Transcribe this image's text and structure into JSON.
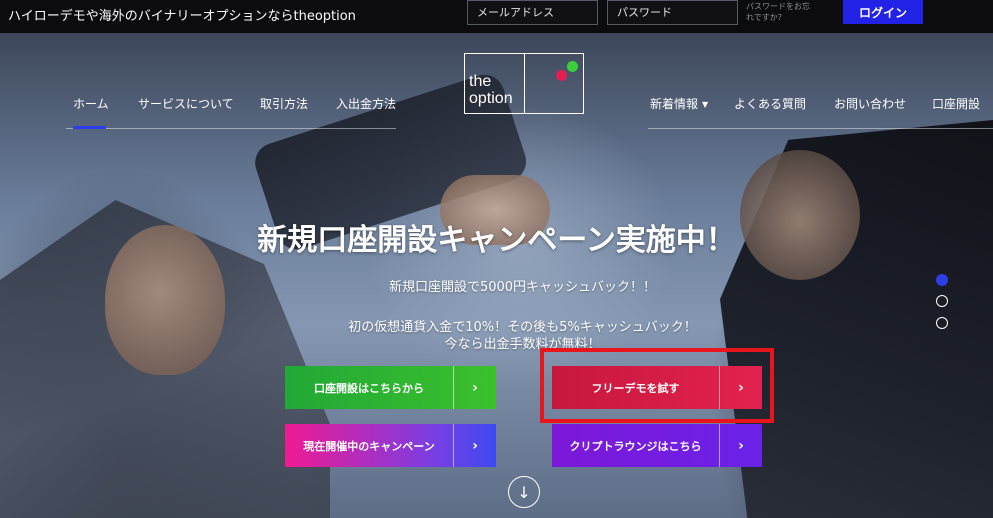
{
  "topbar": {
    "tagline": "ハイローデモや海外のバイナリーオプションならtheoption",
    "email_placeholder": "メールアドレス",
    "password_placeholder": "パスワード",
    "forgot_line1": "パスワードをお忘",
    "forgot_line2": "れですか？",
    "login_label": "ログイン"
  },
  "logo": {
    "line1": "the",
    "line2": "option",
    "dot_colors": [
      "#38d13a",
      "#e3204f"
    ]
  },
  "nav": {
    "left": [
      "ホーム",
      "サービスについて",
      "取引方法",
      "入出金方法"
    ],
    "right": [
      "新着情報",
      "よくある質問",
      "お問い合わせ",
      "口座開設"
    ],
    "active": "ホーム",
    "accent_color": "#2d3ee8"
  },
  "hero": {
    "title": "新規口座開設キャンペーン実施中！",
    "line1": "新規口座開設で5000円キャッシュバック！！",
    "line2": "初の仮想通貨入金で10%！その後も5%キャッシュバック！",
    "line3": "今なら出金手数料が無料！"
  },
  "slider": {
    "count": 3,
    "active_index": 0
  },
  "cta": [
    {
      "label": "口座開設はこちらから",
      "arrow": "›",
      "color": "#2db331"
    },
    {
      "label": "フリーデモを試す",
      "arrow": "›",
      "color": "#d81c46"
    },
    {
      "label": "現在開催中のキャンペーン",
      "arrow": "›",
      "color": "#ef1a92"
    },
    {
      "label": "クリプトラウンジはこちら",
      "arrow": "›",
      "color": "#7320e0"
    }
  ],
  "icons": {
    "scroll": "arrow-down-icon",
    "chevron": "chevron-right-icon",
    "caret": "caret-down-icon"
  },
  "scroll_glyph": "↓",
  "caret_glyph": "▼"
}
